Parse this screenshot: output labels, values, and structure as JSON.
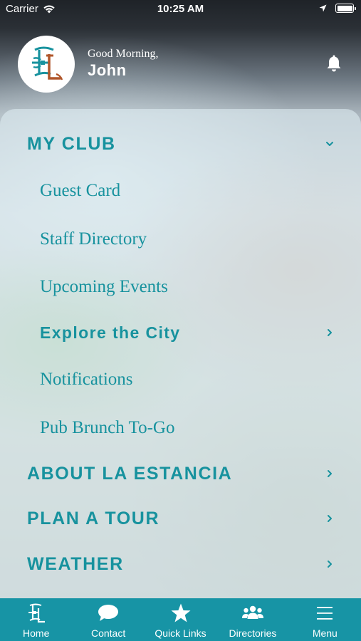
{
  "status_bar": {
    "carrier": "Carrier",
    "time": "10:25 AM"
  },
  "header": {
    "greeting": "Good Morning,",
    "user_name": "John"
  },
  "menu": {
    "my_club": "MY CLUB",
    "guest_card": "Guest Card",
    "staff_directory": "Staff Directory",
    "upcoming_events": "Upcoming Events",
    "explore_city": "Explore the City",
    "notifications": "Notifications",
    "pub_brunch": "Pub Brunch To-Go",
    "about": "ABOUT LA ESTANCIA",
    "plan_tour": "PLAN A TOUR",
    "weather": "WEATHER"
  },
  "tabs": {
    "home": "Home",
    "contact": "Contact",
    "quick_links": "Quick Links",
    "directories": "Directories",
    "menu": "Menu"
  },
  "colors": {
    "accent": "#17929e",
    "tab_bar": "#1794a5",
    "logo_brown": "#b0562a"
  }
}
